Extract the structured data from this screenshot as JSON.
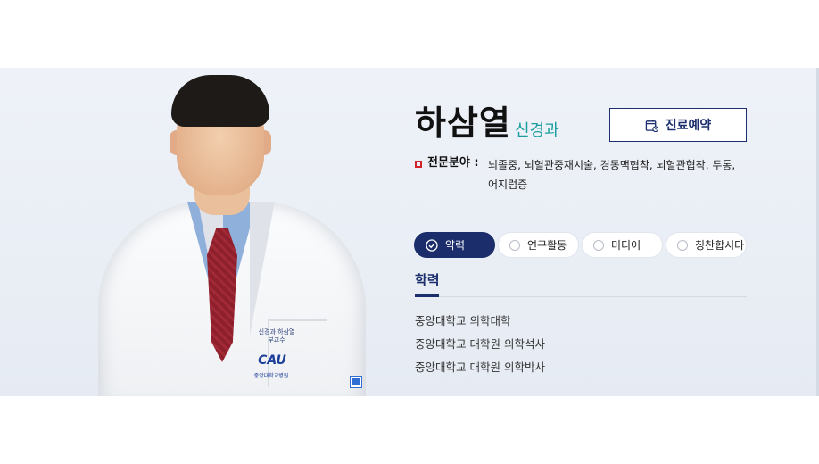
{
  "doctor": {
    "name": "하삼열",
    "department": "신경과",
    "coat_embroidery": [
      "신경과 하삼열",
      "부교수"
    ],
    "badge_logo": "CAU",
    "badge_sub": "중앙대학교병원"
  },
  "reserve_button": {
    "label": "진료예약",
    "icon": "calendar-icon"
  },
  "specialty": {
    "label": "전문분야 :",
    "text": "뇌졸중, 뇌혈관중재시술, 경동맥협착, 뇌혈관협착, 두통, 어지럼증"
  },
  "tabs": [
    {
      "label": "약력",
      "active": true
    },
    {
      "label": "연구활동",
      "active": false
    },
    {
      "label": "미디어",
      "active": false
    },
    {
      "label": "칭찬합시다",
      "active": false
    }
  ],
  "education": {
    "title": "학력",
    "items": [
      "중앙대학교 의학대학",
      "중앙대학교 대학원 의학석사",
      "중앙대학교 대학원 의학박사"
    ]
  },
  "colors": {
    "navy": "#1b2d6b",
    "teal": "#1c9fa0",
    "bullet_red": "#d2232a",
    "banner_bg": "#eef2f8"
  }
}
